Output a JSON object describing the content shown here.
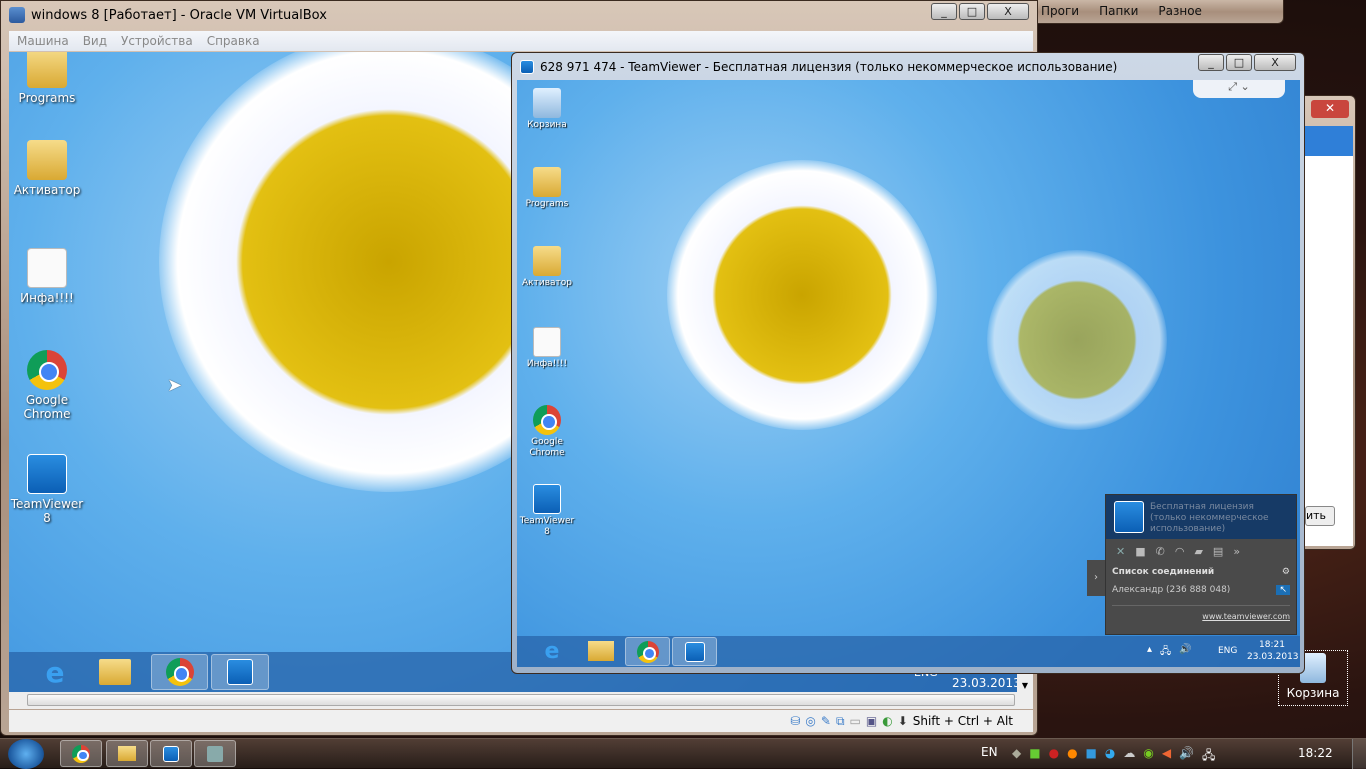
{
  "host": {
    "explorer_toolbar": [
      "Проги",
      "Папки",
      "Разное"
    ],
    "desktop_icon": "Корзина",
    "taskbar": {
      "apps": [
        "chrome-icon",
        "explorer-icon",
        "teamviewer-icon",
        "virtualbox-icon"
      ],
      "lang": "EN",
      "clock": "18:22"
    },
    "side_window": {
      "button_label": "ить"
    }
  },
  "virtualbox": {
    "title": "windows 8 [Работает] - Oracle VM VirtualBox",
    "menu": [
      "Машина",
      "Вид",
      "Устройства",
      "Справка"
    ],
    "status_hotkey": "Shift + Ctrl + Alt",
    "guest": {
      "icons": [
        "Programs",
        "Активатор",
        "Инфа!!!!",
        "Google Chrome",
        "TeamViewer 8"
      ],
      "date": "23.03.2013",
      "lang": "ENG"
    }
  },
  "teamviewer": {
    "title": "628 971 474 - TeamViewer - Бесплатная лицензия (только некоммерческое использование)",
    "remote": {
      "icons": [
        "Корзина",
        "Programs",
        "Активатор",
        "Инфа!!!!",
        "Google Chrome",
        "TeamViewer 8"
      ],
      "lang": "ENG",
      "time": "18:21",
      "date": "23.03.2013"
    },
    "panel": {
      "license": "Бесплатная лицензия (только некоммерческое использование)",
      "connections_header": "Список соединений",
      "connection": "Александр (236 888 048)",
      "link": "www.teamviewer.com"
    }
  }
}
